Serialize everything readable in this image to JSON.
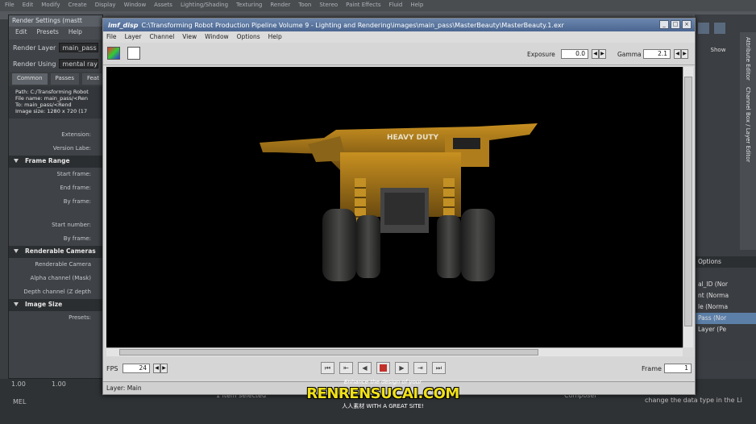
{
  "maya": {
    "menu": [
      "File",
      "Edit",
      "Modify",
      "Create",
      "Display",
      "Window",
      "Assets",
      "Lighting/Shading",
      "Texturing",
      "Render",
      "Toon",
      "Stereo",
      "Paint Effects",
      "Fluid",
      "Help"
    ],
    "right_show_label": "Show",
    "right_vertical_tabs": [
      "Attribute Editor",
      "Channel Box / Layer Editor"
    ],
    "right_list_header": [
      "Options"
    ],
    "right_list_items": [
      {
        "text": "al_ID (Nor",
        "selected": false
      },
      {
        "text": "nt (Norma",
        "selected": false
      },
      {
        "text": "le (Norma",
        "selected": false
      },
      {
        "text": "Pass (Nor",
        "selected": true
      },
      {
        "text": "Layer (Pe",
        "selected": false
      }
    ],
    "bottom": {
      "frame_a": "1.00",
      "frame_b": "1.00",
      "mel_label": "MEL",
      "items_selected": "1 item selected",
      "composer": "Composer",
      "help_text": "change the data type in the Li"
    }
  },
  "render_settings": {
    "title": "Render Settings (mastt",
    "menu": [
      "Edit",
      "Presets",
      "Help"
    ],
    "render_layer_label": "Render Layer",
    "render_layer_value": "main_pass",
    "render_using_label": "Render Using",
    "render_using_value": "mental ray",
    "tabs": [
      "Common",
      "Passes",
      "Feat"
    ],
    "info_lines": [
      "Path: C:/Transforming Robot",
      "File name: main_pass/<Ren",
      "To:       main_pass/<Rend",
      "Image size: 1280 x 720 (17"
    ],
    "extension_label": "Extension:",
    "version_label": "Version Labe:",
    "sections": {
      "frame_range": "Frame Range",
      "renderable_cameras": "Renderable Cameras",
      "image_size": "Image Size"
    },
    "frame_fields": [
      "Start frame:",
      "End frame:",
      "By frame:",
      "Start number:",
      "By frame:"
    ],
    "camera_fields": [
      "Renderable Camera",
      "Alpha channel (Mask)",
      "Depth channel (Z depth"
    ],
    "presets_label": "Presets:"
  },
  "render_view": {
    "app_name": "imf_disp",
    "title_path": "C:\\Transforming Robot Production Pipeline Volume 9 - Lighting and Rendering\\images\\main_pass\\MasterBeauty\\MasterBeauty.1.exr",
    "menu": [
      "File",
      "Layer",
      "Channel",
      "View",
      "Window",
      "Options",
      "Help"
    ],
    "exposure_label": "Exposure",
    "exposure_value": "0.0",
    "gamma_label": "Gamma",
    "gamma_value": "2.1",
    "fps_label": "FPS",
    "fps_value": "24",
    "frame_label": "Frame",
    "frame_value": "1",
    "status": "Layer: Main",
    "truck_text": "HEAVY DUTY",
    "win_ctrl": [
      "_",
      "□",
      "×"
    ]
  },
  "watermark": {
    "tagline": "Enhance the design of your",
    "main": "RENRENSUCAI.COM",
    "sub": "人人素材  WITH A GREAT SITE!"
  }
}
